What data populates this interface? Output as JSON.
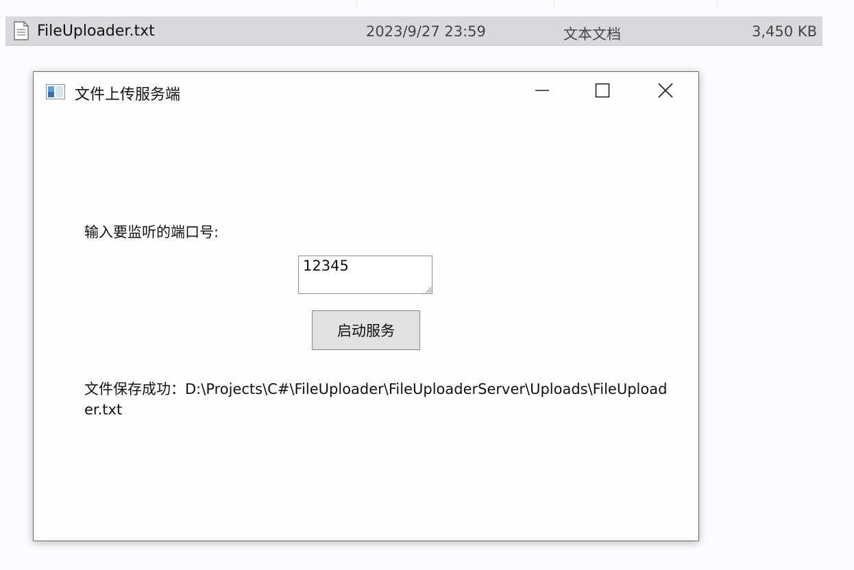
{
  "explorer": {
    "file_icon": "text-document-icon",
    "file_name": "FileUploader.txt",
    "modified": "2023/9/27 23:59",
    "type": "文本文档",
    "size": "3,450 KB"
  },
  "window": {
    "app_icon": "app-window-icon",
    "title": "文件上传服务端",
    "controls": {
      "minimize": "minimize-icon",
      "maximize": "maximize-icon",
      "close": "close-icon"
    }
  },
  "form": {
    "port_label": "输入要监听的端口号:",
    "port_value": "12345",
    "start_button": "启动服务",
    "status": "文件保存成功：D:\\Projects\\C#\\FileUploader\\FileUploaderServer\\Uploads\\FileUploader.txt"
  },
  "colors": {
    "row_highlight": "#d9d9db",
    "button_bg": "#e1e1e1",
    "window_border": "#6b6b6b"
  }
}
